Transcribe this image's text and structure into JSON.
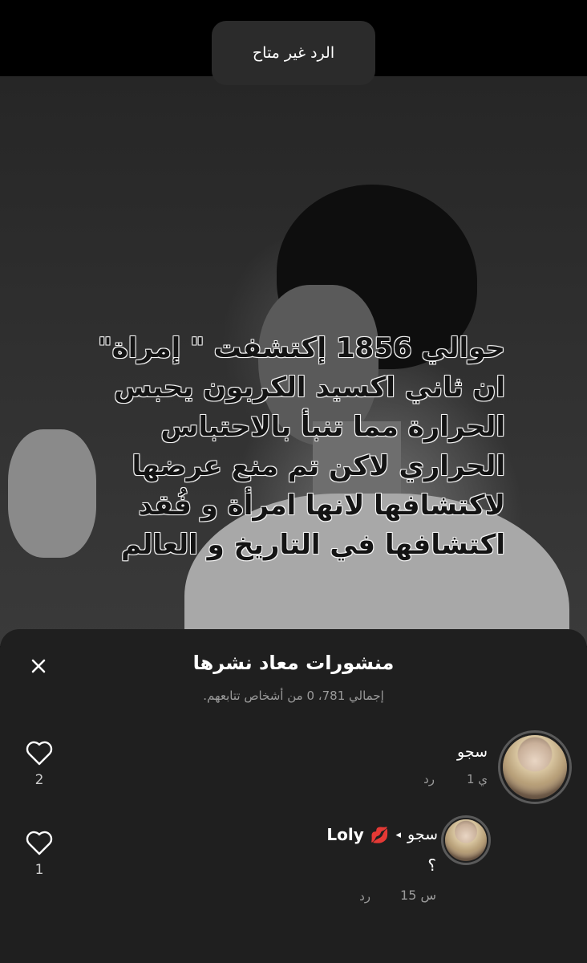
{
  "toast": {
    "text": "الرد غير متاح"
  },
  "post": {
    "overlay_text": "حوالي 1856 إكتشفت \" إمراة\"\nان ثاني اكسيد الكربون يحبس\nالحرارة مما تنبأ بالاحتباس\nالحراري لاكن تم منع عرضها\nلاكتشافها لانها امرأة  و فُقد\nاكتشافها في التاريخ و العالم"
  },
  "sheet": {
    "title": "منشورات معاد نشرها",
    "subtitle": "إجمالي 781، 0 من أشخاص تتابعهم.",
    "close_icon": "close-icon"
  },
  "items": [
    {
      "name": "سجو",
      "time": "1 ي",
      "reply": "رد",
      "likes": "2",
      "avatar_icon": "avatar"
    },
    {
      "name": "سجو",
      "arrow": "◂",
      "target": "Loly",
      "target_emoji": "💋",
      "text": "؟",
      "time": "15 س",
      "reply": "رد",
      "likes": "1",
      "avatar_icon": "avatar"
    }
  ],
  "colors": {
    "sheet_bg": "#1f1f1f",
    "toast_bg": "#2b2b2b",
    "muted": "#9a9a9a"
  }
}
